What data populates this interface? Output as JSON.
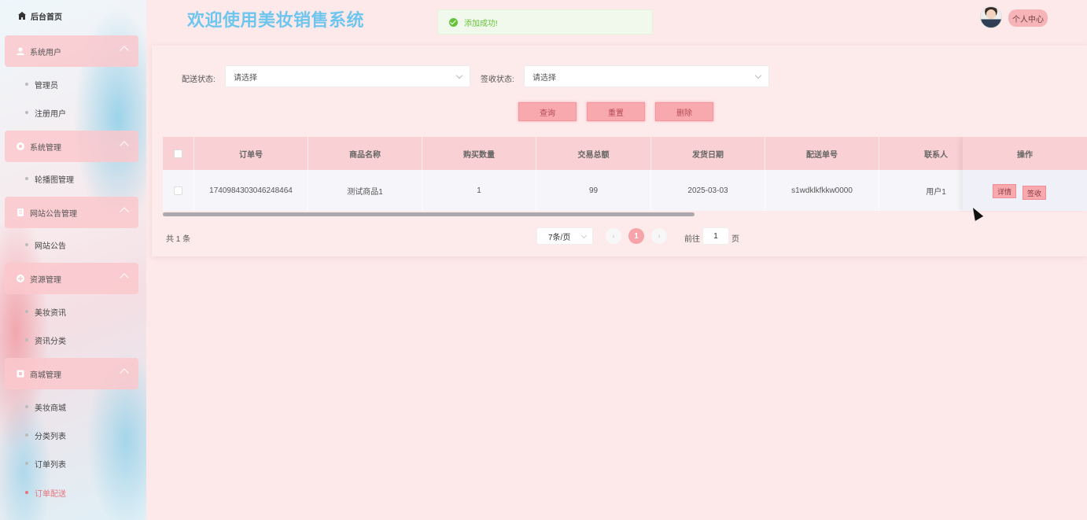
{
  "sidebar": {
    "home": "后台首页",
    "groups": [
      {
        "label": "系统用户",
        "items": [
          "管理员",
          "注册用户"
        ]
      },
      {
        "label": "系统管理",
        "items": [
          "轮播图管理"
        ]
      },
      {
        "label": "网站公告管理",
        "items": [
          "网站公告"
        ]
      },
      {
        "label": "资源管理",
        "items": [
          "美妆资讯",
          "资讯分类"
        ]
      },
      {
        "label": "商城管理",
        "items": [
          "美妆商城",
          "分类列表",
          "订单列表",
          "订单配送"
        ]
      }
    ],
    "active_item": "订单配送"
  },
  "header": {
    "title": "欢迎使用美妆销售系统",
    "profile_button": "个人中心"
  },
  "toast": {
    "message": "添加成功!"
  },
  "filters": {
    "delivery_status_label": "配送状态:",
    "delivery_status_value": "请选择",
    "receipt_status_label": "签收状态:",
    "receipt_status_value": "请选择"
  },
  "actions": {
    "query": "查询",
    "reset": "重置",
    "delete": "删除"
  },
  "table": {
    "columns": [
      "订单号",
      "商品名称",
      "购买数量",
      "交易总额",
      "发货日期",
      "配送单号",
      "联系人",
      "操作"
    ],
    "rows": [
      {
        "order_no": "1740984303046248464",
        "product": "测试商品1",
        "qty": "1",
        "total": "99",
        "ship_date": "2025-03-03",
        "delivery_no": "s1wdklkfkkw0000",
        "contact": "用户1",
        "detail_btn": "详情",
        "sign_btn": "签收"
      }
    ]
  },
  "pagination": {
    "total": "共 1 条",
    "page_size": "7条/页",
    "current_page": "1",
    "goto_prefix": "前往",
    "goto_value": "1",
    "goto_suffix": "页"
  },
  "colors": {
    "accent": "#f8a9ae",
    "title": "#6ec6ee",
    "success": "#67c23a",
    "active_nav": "#e8737c"
  }
}
